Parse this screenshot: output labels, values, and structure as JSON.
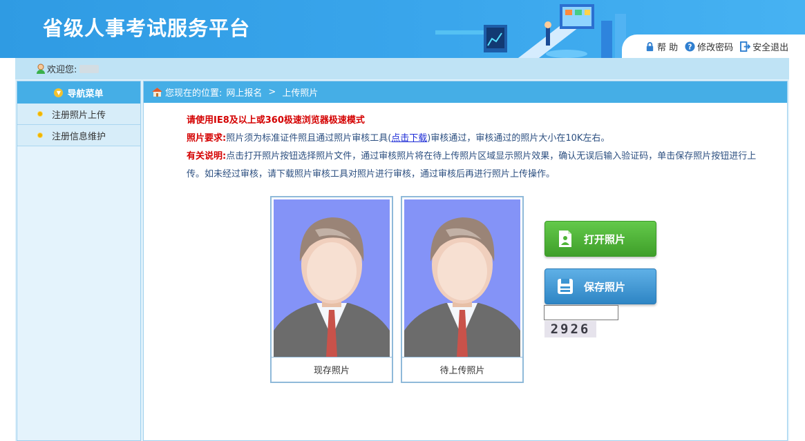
{
  "header": {
    "site_title": "省级人事考试服务平台",
    "links": [
      {
        "label": "帮 助",
        "icon": "lock-icon"
      },
      {
        "label": "修改密码",
        "icon": "question-icon"
      },
      {
        "label": "安全退出",
        "icon": "exit-icon"
      }
    ]
  },
  "welcome": {
    "label": "欢迎您:"
  },
  "sidebar": {
    "title": "导航菜单",
    "items": [
      {
        "label": "注册照片上传"
      },
      {
        "label": "注册信息维护"
      }
    ]
  },
  "breadcrumb": {
    "prefix": "您现在的位置:",
    "level1": "网上报名",
    "separator": ">",
    "level2": "上传照片"
  },
  "notes": {
    "browser_warning": "请使用IE8及以上或360极速浏览器极速模式",
    "req_label": "照片要求:",
    "req_text_before": "照片须为标准证件照且通过照片审核工具(",
    "req_link": "点击下载",
    "req_text_after": ")审核通过，审核通过的照片大小在10K左右。",
    "info_label": "有关说明:",
    "info_text": "点击打开照片按钮选择照片文件，通过审核照片将在待上传照片区域显示照片效果，确认无误后输入验证码，单击保存照片按钮进行上传。如未经过审核，请下载照片审核工具对照片进行审核，通过审核后再进行照片上传操作。"
  },
  "photos": {
    "current_caption": "现存照片",
    "pending_caption": "待上传照片"
  },
  "buttons": {
    "open_label": "打开照片",
    "save_label": "保存照片"
  },
  "captcha": {
    "value": "",
    "code": "2926"
  },
  "colors": {
    "header_blue": "#3aa6ec",
    "bar_blue": "#45aee6",
    "warning_red": "#d40000",
    "open_green": "#4fb536",
    "save_blue": "#3c95d3",
    "photo_bg": "#8493f7"
  }
}
